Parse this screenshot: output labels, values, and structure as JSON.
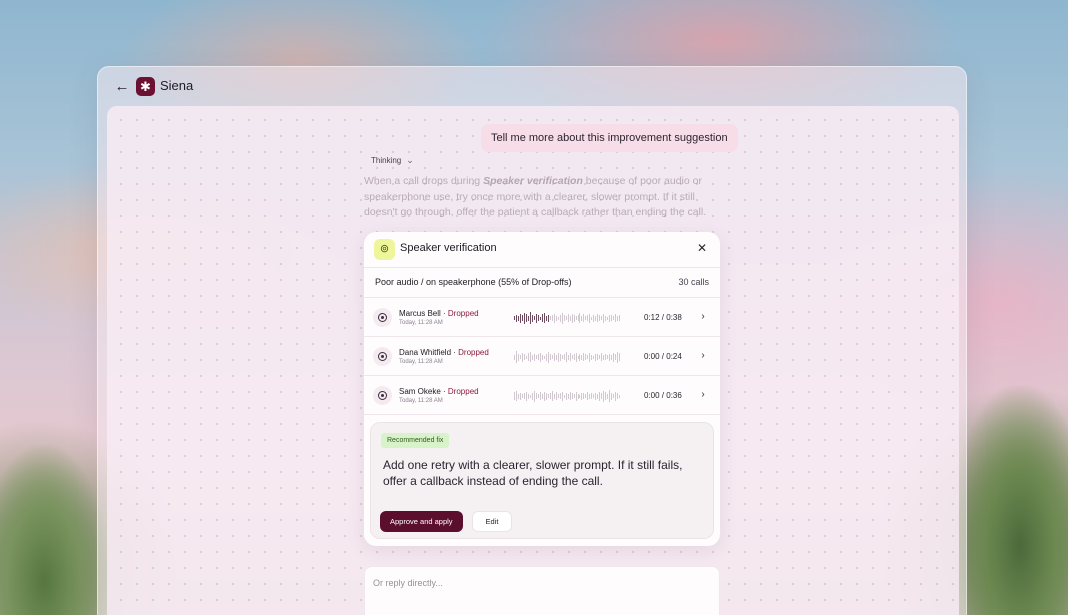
{
  "app": {
    "name": "Siena"
  },
  "conversation": {
    "user_message": "Tell me more about this improvement suggestion",
    "thinking_label": "Thinking",
    "assistant_text": {
      "part1": "When a call drops during ",
      "emphasis": "Speaker verification",
      "part2": " because of poor audio or speakerphone use, try once more with a clearer, slower prompt. If it still doesn't go through, offer the patient a callback rather than ending the call."
    }
  },
  "card": {
    "title": "Speaker verification",
    "icon": "fingerprint-icon",
    "segment_label": "Poor audio / on speakerphone (55% of Drop-offs)",
    "segment_count": "30 calls",
    "calls": [
      {
        "name": "Marcus Bell",
        "status": "Dropped",
        "time": "Today, 11:28 AM",
        "duration": "0:12 / 0:38",
        "progress": 0.32
      },
      {
        "name": "Dana Whitfield",
        "status": "Dropped",
        "time": "Today, 11:28 AM",
        "duration": "0:00 / 0:24",
        "progress": 0
      },
      {
        "name": "Sam Okeke",
        "status": "Dropped",
        "time": "Today, 11:28 AM",
        "duration": "0:00 / 0:36",
        "progress": 0
      }
    ],
    "fix": {
      "badge": "Recommended fix",
      "text": "Add one retry with a clearer, slower prompt. If it still fails, offer a callback instead of ending the call.",
      "approve_label": "Approve and apply",
      "edit_label": "Edit"
    }
  },
  "reply": {
    "placeholder": "Or reply directly..."
  },
  "colors": {
    "brand": "#6b1233",
    "approve_button": "#5c0f2c",
    "dropped_status": "#8a1c3c",
    "fix_badge_bg": "#d8f3c9",
    "user_bubble": "#f7dde8",
    "card_icon_bg": "#eef59a"
  },
  "icons": {
    "back": "arrow-left-icon",
    "logo": "siena-logo-icon",
    "thinking": "chevron-down-icon",
    "close": "close-icon",
    "play": "play-icon",
    "row": "chevron-right-icon"
  }
}
